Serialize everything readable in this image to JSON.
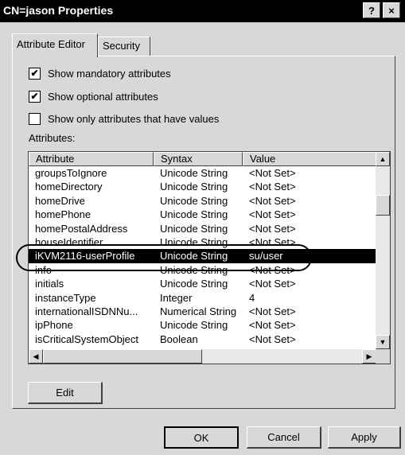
{
  "window": {
    "title": "CN=jason Properties",
    "help_label": "?",
    "close_label": "×"
  },
  "tabs": [
    {
      "label": "Attribute Editor",
      "active": true
    },
    {
      "label": "Security",
      "active": false
    }
  ],
  "options": [
    {
      "label": "Show mandatory attributes",
      "checked": true
    },
    {
      "label": "Show optional attributes",
      "checked": true
    },
    {
      "label": "Show only attributes that have values",
      "checked": false
    }
  ],
  "attributes_label": "Attributes:",
  "list": {
    "columns": [
      "Attribute",
      "Syntax",
      "Value"
    ],
    "rows": [
      [
        "groupsToIgnore",
        "Unicode String",
        "<Not Set>"
      ],
      [
        "homeDirectory",
        "Unicode String",
        "<Not Set>"
      ],
      [
        "homeDrive",
        "Unicode String",
        "<Not Set>"
      ],
      [
        "homePhone",
        "Unicode String",
        "<Not Set>"
      ],
      [
        "homePostalAddress",
        "Unicode String",
        "<Not Set>"
      ],
      [
        "houseIdentifier",
        "Unicode String",
        "<Not Set>"
      ],
      [
        "iKVM2116-userProfile",
        "Unicode String",
        "su/user"
      ],
      [
        "info",
        "Unicode String",
        "<Not Set>"
      ],
      [
        "initials",
        "Unicode String",
        "<Not Set>"
      ],
      [
        "instanceType",
        "Integer",
        "4"
      ],
      [
        "internationalISDNNu...",
        "Numerical String",
        "<Not Set>"
      ],
      [
        "ipPhone",
        "Unicode String",
        "<Not Set>"
      ],
      [
        "isCriticalSystemObject",
        "Boolean",
        "<Not Set>"
      ]
    ],
    "selected_row": "iKVM2116-userProfile"
  },
  "buttons": {
    "edit": "Edit",
    "ok": "OK",
    "cancel": "Cancel",
    "apply": "Apply"
  },
  "icons": {
    "check": "✔",
    "scroll_up": "▲",
    "scroll_down": "▼",
    "scroll_left": "◀",
    "scroll_right": "▶"
  }
}
